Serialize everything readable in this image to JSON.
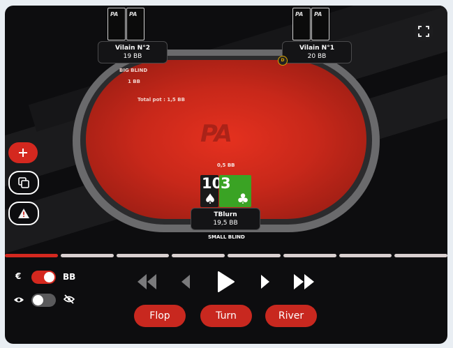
{
  "brand_logo_text": "PA",
  "players": {
    "top_left": {
      "name": "Vilain N°2",
      "stack": "19 BB",
      "position_label": "BIG BLIND",
      "bet": "1 BB"
    },
    "top_right": {
      "name": "Vilain N°1",
      "stack": "20 BB"
    },
    "hero": {
      "name": "TBlurn",
      "stack": "19,5 BB",
      "position_label": "SMALL BLIND",
      "bet": "0,5 BB"
    }
  },
  "dealer_button": "D",
  "pot": "Total pot : 1,5 BB",
  "hero_cards": [
    {
      "rank": "10",
      "suit": "♠",
      "color": "#1a1a1a"
    },
    {
      "rank": "3",
      "suit": "♣",
      "color": "#3aa324"
    }
  ],
  "controls": {
    "currency_symbol": "€",
    "unit_label": "BB",
    "unit_toggle_on": true,
    "visibility_toggle_on": false
  },
  "streets": {
    "flop": "Flop",
    "turn": "Turn",
    "river": "River"
  },
  "timeline": {
    "total_steps": 8,
    "active_step": 1
  },
  "colors": {
    "accent": "#d4281f",
    "felt": "#c8281a",
    "background": "#0d0d0f"
  }
}
